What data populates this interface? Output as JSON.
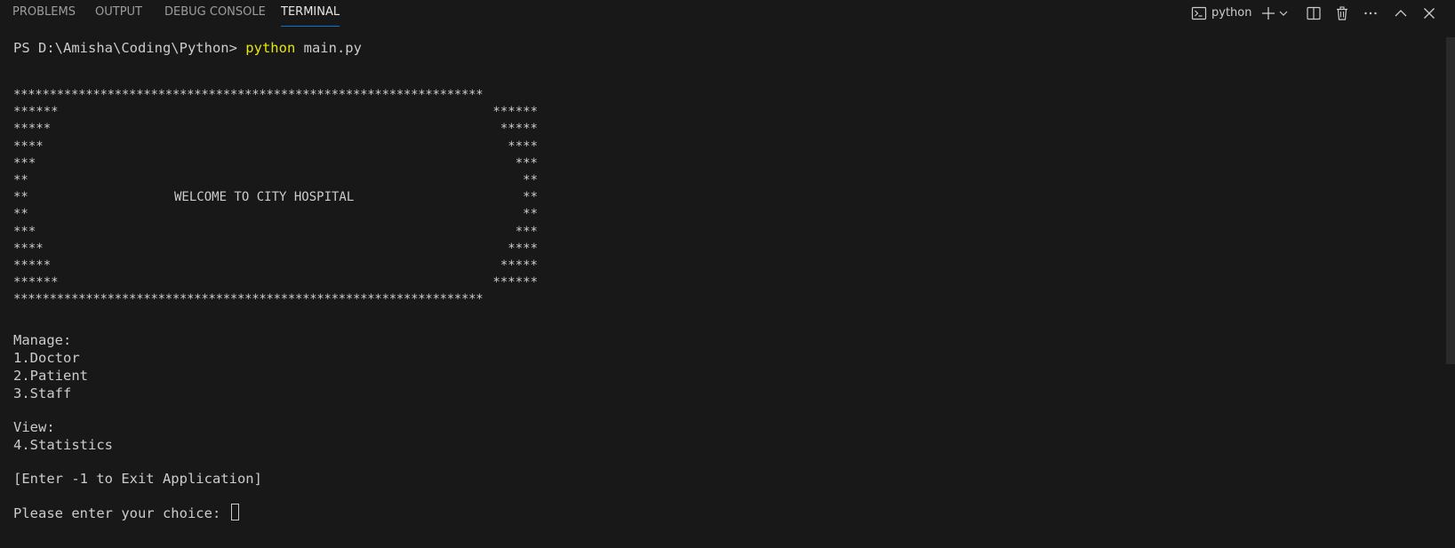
{
  "tabs": [
    {
      "label": "PROBLEMS",
      "active": false
    },
    {
      "label": "OUTPUT",
      "active": false
    },
    {
      "label": "DEBUG CONSOLE",
      "active": false
    },
    {
      "label": "TERMINAL",
      "active": true
    }
  ],
  "toolbar": {
    "profile_label": "python",
    "icons": [
      "terminal-icon",
      "plus-icon",
      "chevron-down-icon",
      "split-icon",
      "trash-icon",
      "more-icon",
      "chevron-up-icon",
      "close-icon"
    ]
  },
  "terminal": {
    "prompt": "PS D:\\Amisha\\Coding\\Python> ",
    "command": "python",
    "args": " main.py",
    "banner": {
      "border": "*****************************************************************",
      "rows": [
        {
          "left": "******",
          "right": "******"
        },
        {
          "left": "*****",
          "right": "*****"
        },
        {
          "left": "****",
          "right": "****"
        },
        {
          "left": "***",
          "right": "***"
        },
        {
          "left": "**",
          "right": "**"
        },
        {
          "left": "**",
          "right": "**",
          "text": "WELCOME TO CITY HOSPITAL"
        },
        {
          "left": "**",
          "right": "**"
        },
        {
          "left": "***",
          "right": "***"
        },
        {
          "left": "****",
          "right": "****"
        },
        {
          "left": "*****",
          "right": "*****"
        },
        {
          "left": "******",
          "right": "******"
        }
      ]
    },
    "menu": {
      "manage_label": "Manage:",
      "items": [
        "1.Doctor",
        "2.Patient",
        "3.Staff"
      ],
      "view_label": "View:",
      "view_items": [
        "4.Statistics"
      ],
      "exit_hint": "[Enter -1 to Exit Application]",
      "input_prompt": "Please enter your choice: "
    }
  },
  "colors": {
    "background": "#181818",
    "text": "#cccccc",
    "command": "#e5e510",
    "active_tab_underline": "#0078d4"
  }
}
